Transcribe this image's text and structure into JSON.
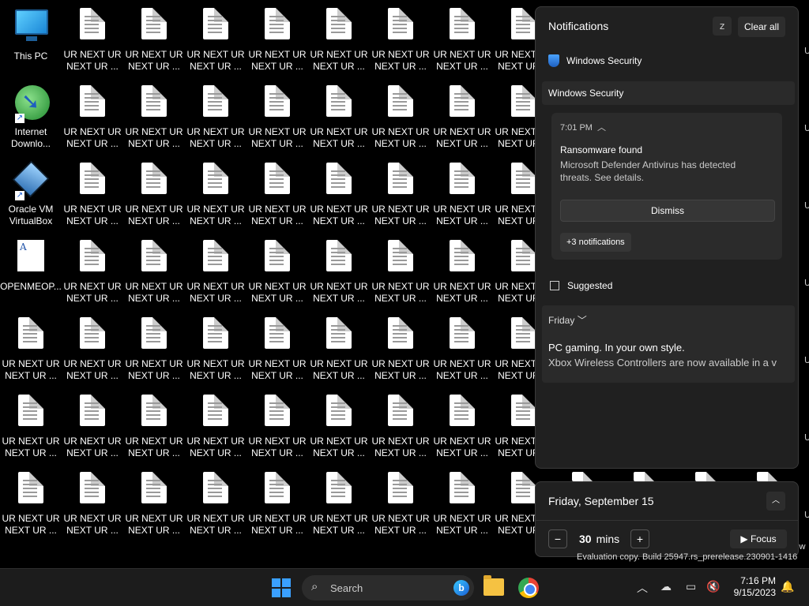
{
  "desktop": {
    "this_pc": "This PC",
    "internet_download": "Internet\nDownlo...",
    "virtualbox": "Oracle VM\nVirtualBox",
    "openmeop": "OPENMEOP...",
    "doc_file_label": "UR NEXT UR\nNEXT UR ..."
  },
  "notifications": {
    "title": "Notifications",
    "snooze_icon": "bell-snooze-icon",
    "clear_all": "Clear all",
    "app_row": "Windows Security",
    "group_header": "Windows Security",
    "toast": {
      "time": "7:01 PM",
      "title": "Ransomware found",
      "body": "Microsoft Defender Antivirus has detected threats. See details.",
      "dismiss": "Dismiss",
      "more": "+3 notifications"
    },
    "suggested": "Suggested",
    "friday_group": {
      "day": "Friday",
      "title": "PC gaming. In your own style.",
      "body": "Xbox Wireless Controllers are now available in a v"
    }
  },
  "calendar": {
    "date": "Friday, September 15",
    "minutes_value": "30",
    "minutes_unit": "mins",
    "focus": "Focus"
  },
  "watermark": "Evaluation copy. Build 25947.rs_prerelease.230901-1416",
  "taskbar": {
    "search_placeholder": "Search",
    "time": "7:16 PM",
    "date": "9/15/2023"
  }
}
